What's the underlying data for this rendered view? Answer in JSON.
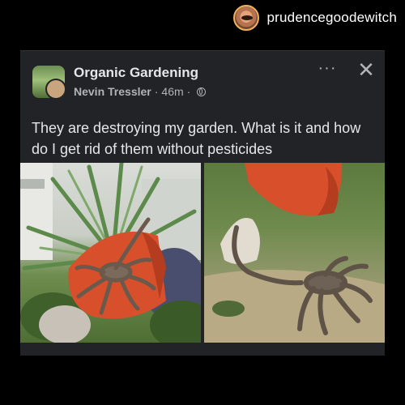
{
  "instagram": {
    "username": "prudencegoodewitch"
  },
  "post": {
    "group_name": "Organic Gardening",
    "author": "Nevin Tressler",
    "time": "46m",
    "separator": "·",
    "more_label": "···",
    "close_label": "✕",
    "text": "They are destroying my garden. What is it and how do I get rid of them without pesticides"
  },
  "icons": {
    "globe": "globe-icon",
    "more": "more-options-icon",
    "close": "close-icon"
  },
  "colors": {
    "page_background": "#000000",
    "post_background": "#222326",
    "primary_text": "#e4e6eb",
    "secondary_text": "#b0b3b8",
    "avatar_ring": "#f2b15c"
  }
}
